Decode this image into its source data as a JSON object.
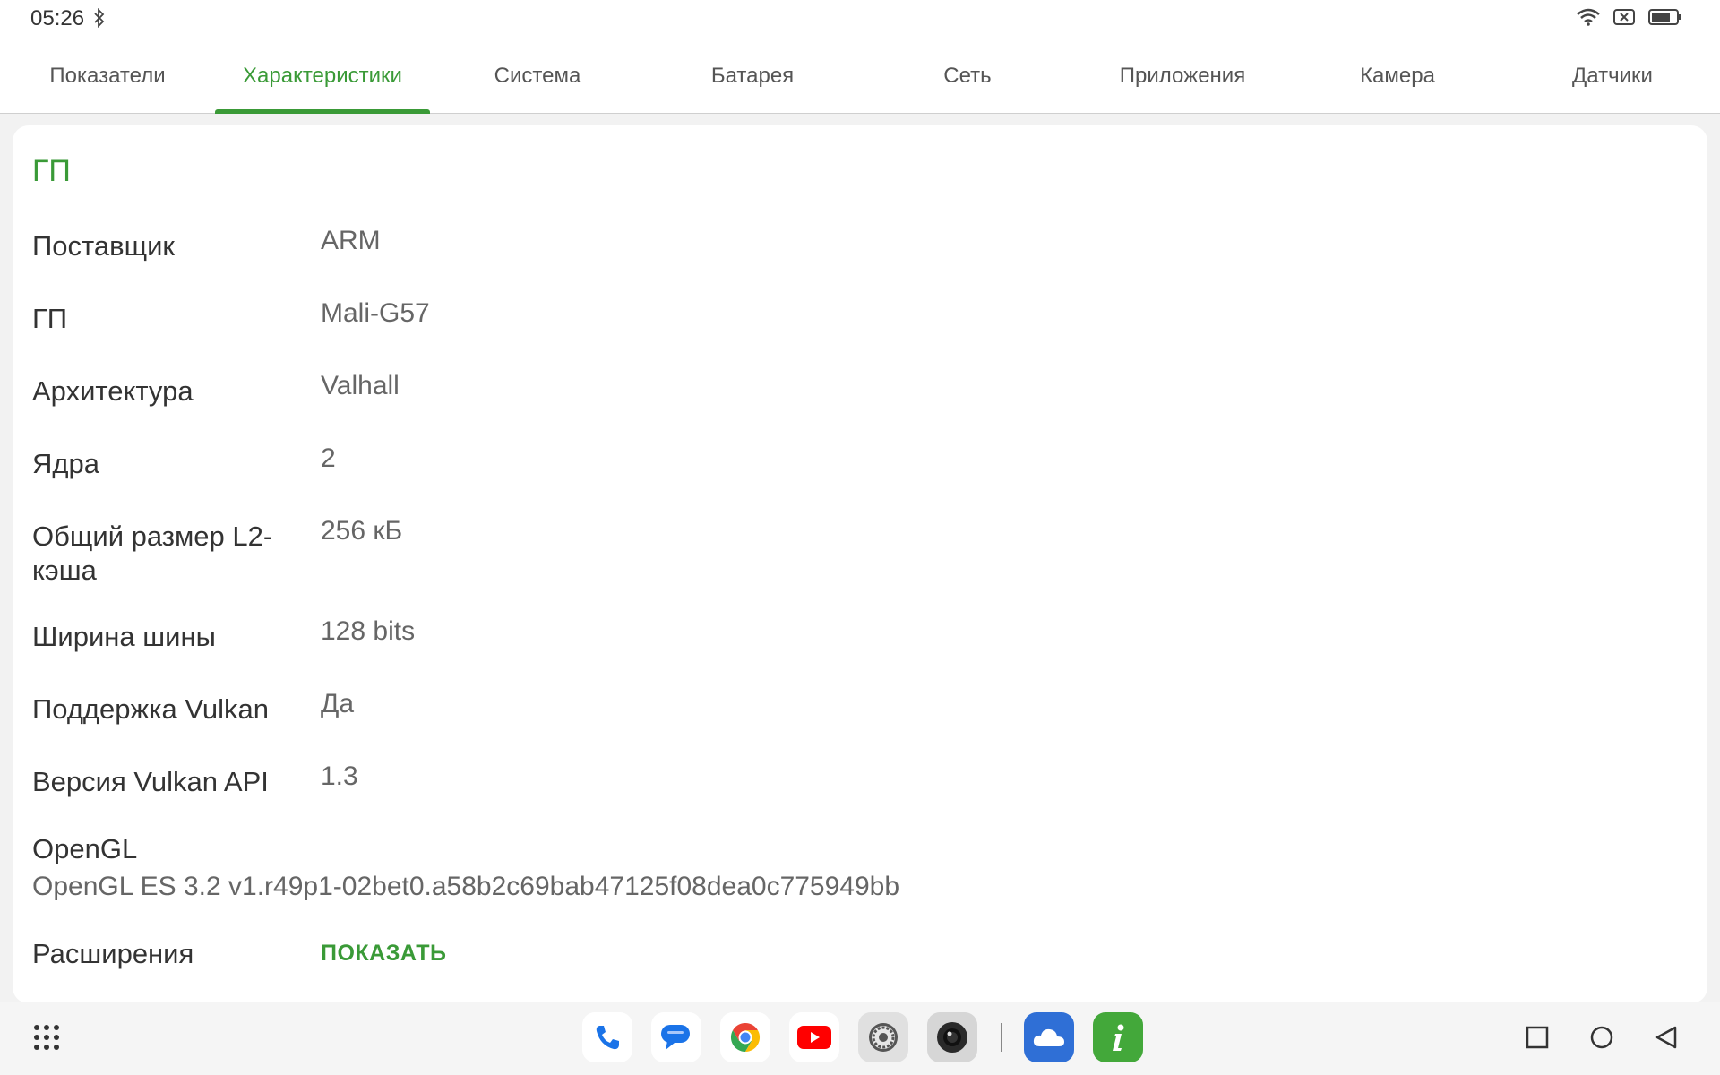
{
  "statusbar": {
    "time": "05:26"
  },
  "tabs": [
    {
      "label": "Показатели"
    },
    {
      "label": "Характеристики"
    },
    {
      "label": "Система"
    },
    {
      "label": "Батарея"
    },
    {
      "label": "Сеть"
    },
    {
      "label": "Приложения"
    },
    {
      "label": "Камера"
    },
    {
      "label": "Датчики"
    }
  ],
  "active_tab": "Характеристики",
  "gpu": {
    "title": "ГП",
    "rows": [
      {
        "label": "Поставщик",
        "value": "ARM"
      },
      {
        "label": "ГП",
        "value": "Mali-G57"
      },
      {
        "label": "Архитектура",
        "value": "Valhall"
      },
      {
        "label": "Ядра",
        "value": "2"
      },
      {
        "label": "Общий размер L2-кэша",
        "value": "256 кБ"
      },
      {
        "label": "Ширина шины",
        "value": "128 bits"
      },
      {
        "label": "Поддержка Vulkan",
        "value": "Да"
      },
      {
        "label": "Версия Vulkan API",
        "value": "1.3"
      }
    ],
    "opengl_label": "OpenGL",
    "opengl_value": "OpenGL ES 3.2 v1.r49p1-02bet0.a58b2c69bab47125f08dea0c775949bb",
    "extensions_label": "Расширения",
    "extensions_button": "ПОКАЗАТЬ"
  },
  "colors": {
    "accent": "#3a9a37"
  },
  "dock_apps": [
    "phone-icon",
    "messages-icon",
    "chrome-icon",
    "youtube-icon",
    "settings-icon",
    "camera-icon",
    "cloud-icon",
    "device-info-icon"
  ]
}
